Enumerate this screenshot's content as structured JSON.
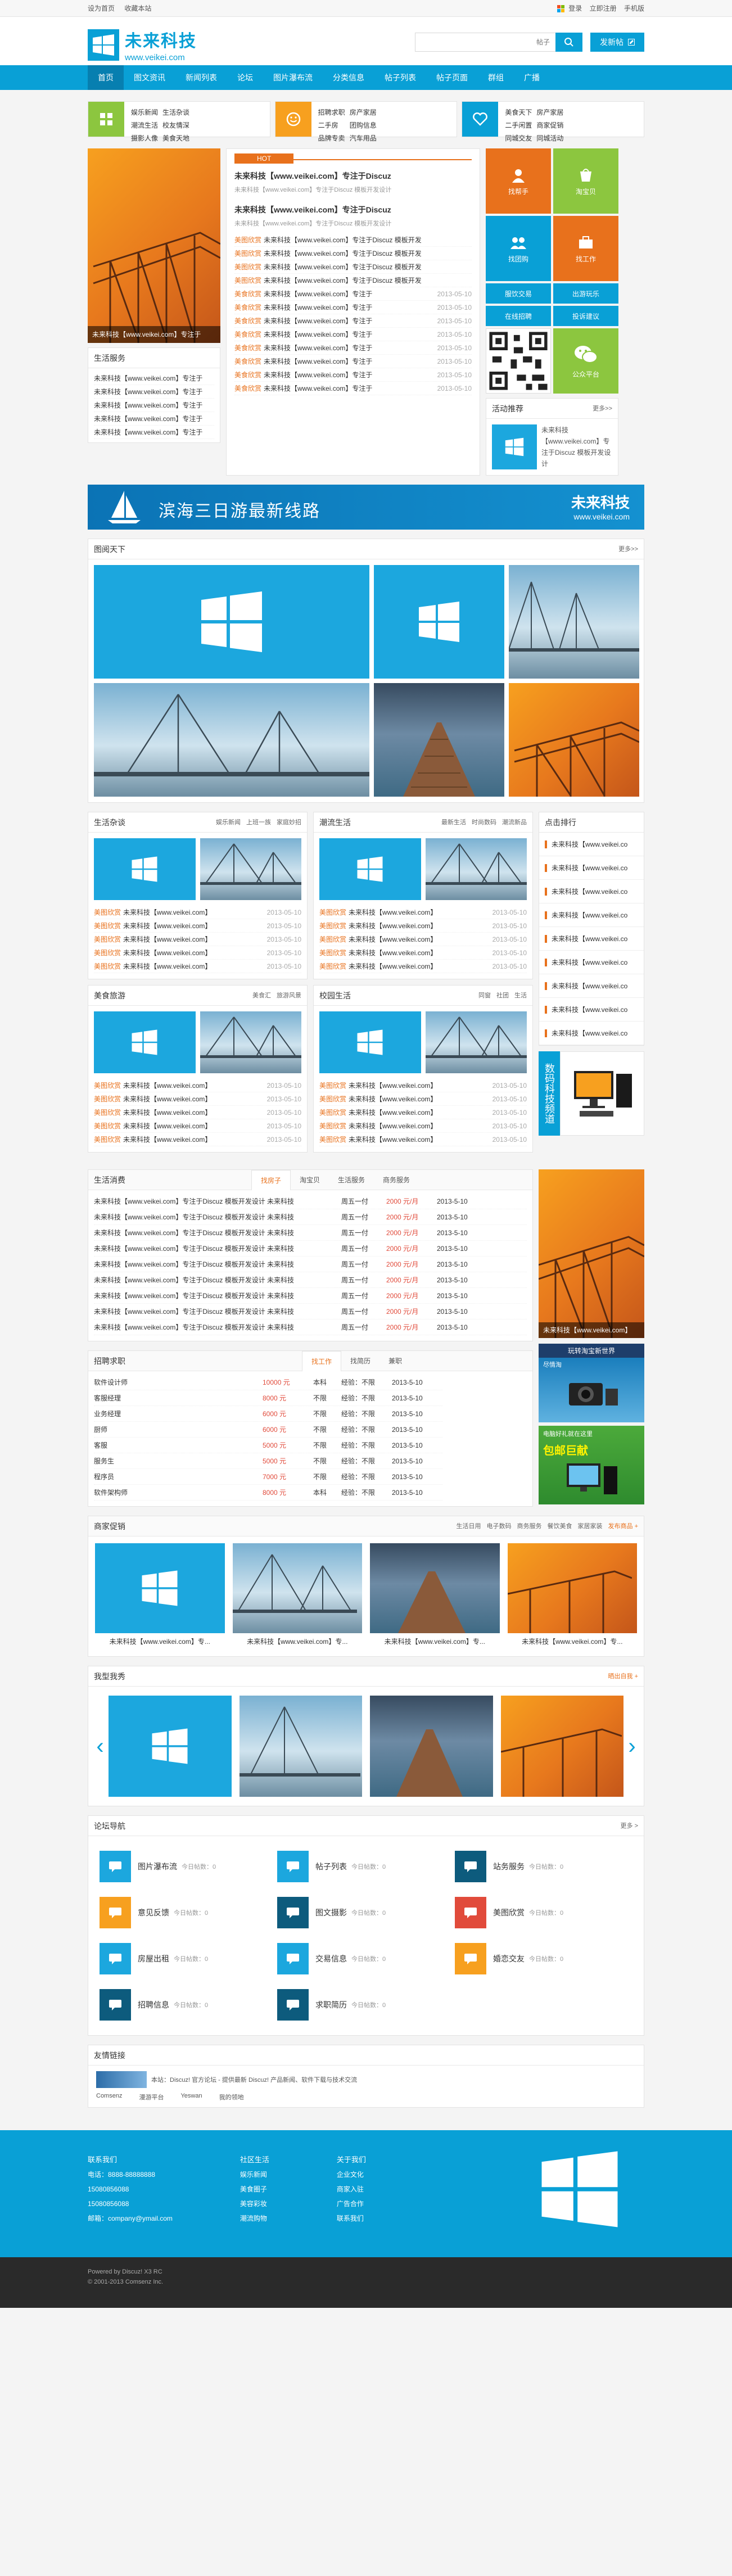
{
  "topbar": {
    "set_home": "设为首页",
    "favorite": "收藏本站",
    "login": "登录",
    "register": "立即注册",
    "mobile": "手机版"
  },
  "brand": {
    "name": "未来科技",
    "url": "www.veikei.com",
    "color": "#09a0d6"
  },
  "search": {
    "placeholder": "帖子",
    "button_icon": "search-icon"
  },
  "header": {
    "post_button": "发新帖"
  },
  "nav": [
    "首页",
    "图文资讯",
    "新闻列表",
    "论坛",
    "图片瀑布流",
    "分类信息",
    "帖子列表",
    "帖子页面",
    "群组",
    "广播"
  ],
  "subnav": [
    {
      "links": [
        "娱乐新闻",
        "生活杂谈",
        "潮流生活",
        "校友情深",
        "摄影人像",
        "美食天地"
      ]
    },
    {
      "links": [
        "招聘求职",
        "房产家居",
        "二手房",
        "团购信息",
        "品牌专卖",
        "汽车用品"
      ]
    },
    {
      "links": [
        "美食天下",
        "房产家居",
        "二手闲置",
        "商家促销",
        "同城交友",
        "同城活动"
      ]
    }
  ],
  "hero": {
    "caption": "未来科技【www.veikei.com】专注于",
    "hot_label": "HOT",
    "headline1": "未来科技【www.veikei.com】专注于Discuz",
    "desc1": "未来科技【www.veikei.com】专注于Discuz 模板开发设计",
    "headline2": "未来科技【www.veikei.com】专注于Discuz",
    "desc2": "未来科技【www.veikei.com】专注于Discuz 模板开发设计"
  },
  "hero_list": [
    {
      "tag": "美图欣赏",
      "title": "未来科技【www.veikei.com】专注于Discuz 模板开发"
    },
    {
      "tag": "美图欣赏",
      "title": "未来科技【www.veikei.com】专注于Discuz 模板开发"
    },
    {
      "tag": "美图欣赏",
      "title": "未来科技【www.veikei.com】专注于Discuz 模板开发"
    },
    {
      "tag": "美图欣赏",
      "title": "未来科技【www.veikei.com】专注于Discuz 模板开发"
    },
    {
      "tag": "美食欣赏",
      "title": "未来科技【www.veikei.com】专注于",
      "date": "2013-05-10"
    },
    {
      "tag": "美食欣赏",
      "title": "未来科技【www.veikei.com】专注于",
      "date": "2013-05-10"
    },
    {
      "tag": "美食欣赏",
      "title": "未来科技【www.veikei.com】专注于",
      "date": "2013-05-10"
    },
    {
      "tag": "美食欣赏",
      "title": "未来科技【www.veikei.com】专注于",
      "date": "2013-05-10"
    },
    {
      "tag": "美食欣赏",
      "title": "未来科技【www.veikei.com】专注于",
      "date": "2013-05-10"
    },
    {
      "tag": "美食欣赏",
      "title": "未来科技【www.veikei.com】专注于",
      "date": "2013-05-10"
    },
    {
      "tag": "美食欣赏",
      "title": "未来科技【www.veikei.com】专注于",
      "date": "2013-05-10"
    },
    {
      "tag": "美食欣赏",
      "title": "未来科技【www.veikei.com】专注于",
      "date": "2013-05-10"
    }
  ],
  "life_box": {
    "title": "生活服务",
    "items": [
      "未来科技【www.veikei.com】专注于",
      "未来科技【www.veikei.com】专注于",
      "未来科技【www.veikei.com】专注于",
      "未来科技【www.veikei.com】专注于",
      "未来科技【www.veikei.com】专注于"
    ]
  },
  "tiles": [
    {
      "label": "找帮手",
      "color": "#e8711c"
    },
    {
      "label": "淘宝贝",
      "color": "#8cc63f"
    },
    {
      "label": "找团购",
      "color": "#09a0d6"
    },
    {
      "label": "找工作",
      "color": "#e8711c"
    }
  ],
  "tile_buttons": [
    "服饮交易",
    "出游玩乐",
    "在线招聘",
    "投诉建议"
  ],
  "wechat": {
    "label": "公众平台"
  },
  "activity": {
    "title": "活动推荐",
    "more": "更多>>",
    "text": "未来科技【www.veikei.com】专注于Discuz 模板开发设计"
  },
  "banner": {
    "text": "滨海三日游最新线路",
    "brand": "未来科技",
    "url": "www.veikei.com"
  },
  "gallery": {
    "title": "图阅天下",
    "more": "更多>>"
  },
  "modules": [
    {
      "title": "生活杂谈",
      "tabs": [
        "娱乐新闻",
        "上班一族",
        "家庭妙招"
      ]
    },
    {
      "title": "潮流生活",
      "tabs": [
        "最新生活",
        "时尚数码",
        "潮流新品"
      ]
    },
    {
      "title": "美食旅游",
      "tabs": [
        "美食汇",
        "旅游风景"
      ]
    },
    {
      "title": "校园生活",
      "tabs": [
        "同窗",
        "社团",
        "生活"
      ]
    }
  ],
  "module_list": [
    {
      "tag": "美图欣赏",
      "title": "未来科技【www.veikei.com】",
      "date": "2013-05-10"
    },
    {
      "tag": "美图欣赏",
      "title": "未来科技【www.veikei.com】",
      "date": "2013-05-10"
    },
    {
      "tag": "美图欣赏",
      "title": "未来科技【www.veikei.com】",
      "date": "2013-05-10"
    },
    {
      "tag": "美图欣赏",
      "title": "未来科技【www.veikei.com】",
      "date": "2013-05-10"
    },
    {
      "tag": "美图欣赏",
      "title": "未来科技【www.veikei.com】",
      "date": "2013-05-10"
    }
  ],
  "ranking": {
    "title": "点击排行",
    "items": [
      "未来科技【www.veikei.co",
      "未来科技【www.veikei.co",
      "未来科技【www.veikei.co",
      "未来科技【www.veikei.co",
      "未来科技【www.veikei.co",
      "未来科技【www.veikei.co",
      "未来科技【www.veikei.co",
      "未来科技【www.veikei.co",
      "未来科技【www.veikei.co"
    ]
  },
  "digital": {
    "label": "数码科技频道"
  },
  "consume": {
    "title": "生活消费",
    "tabs": [
      "找房子",
      "淘宝贝",
      "生活服务",
      "商务服务"
    ],
    "rows": [
      {
        "t": "未来科技【www.veikei.com】专注于Discuz 模板开发设计 未来科技",
        "p": "周五一付",
        "price": "2000 元/月",
        "d": "2013-5-10"
      },
      {
        "t": "未来科技【www.veikei.com】专注于Discuz 模板开发设计 未来科技",
        "p": "周五一付",
        "price": "2000 元/月",
        "d": "2013-5-10"
      },
      {
        "t": "未来科技【www.veikei.com】专注于Discuz 模板开发设计 未来科技",
        "p": "周五一付",
        "price": "2000 元/月",
        "d": "2013-5-10"
      },
      {
        "t": "未来科技【www.veikei.com】专注于Discuz 模板开发设计 未来科技",
        "p": "周五一付",
        "price": "2000 元/月",
        "d": "2013-5-10"
      },
      {
        "t": "未来科技【www.veikei.com】专注于Discuz 模板开发设计 未来科技",
        "p": "周五一付",
        "price": "2000 元/月",
        "d": "2013-5-10"
      },
      {
        "t": "未来科技【www.veikei.com】专注于Discuz 模板开发设计 未来科技",
        "p": "周五一付",
        "price": "2000 元/月",
        "d": "2013-5-10"
      },
      {
        "t": "未来科技【www.veikei.com】专注于Discuz 模板开发设计 未来科技",
        "p": "周五一付",
        "price": "2000 元/月",
        "d": "2013-5-10"
      },
      {
        "t": "未来科技【www.veikei.com】专注于Discuz 模板开发设计 未来科技",
        "p": "周五一付",
        "price": "2000 元/月",
        "d": "2013-5-10"
      },
      {
        "t": "未来科技【www.veikei.com】专注于Discuz 模板开发设计 未来科技",
        "p": "周五一付",
        "price": "2000 元/月",
        "d": "2013-5-10"
      }
    ]
  },
  "side_caption": "未来科技【www.veikei.com】",
  "ads": [
    {
      "title": "玩转淘宝新世界",
      "sub": "尽情淘"
    },
    {
      "title": "电脑好礼就在这里",
      "sub": "包邮巨献"
    }
  ],
  "jobs": {
    "title": "招聘求职",
    "tabs": [
      "找工作",
      "找简历",
      "兼职"
    ],
    "rows": [
      {
        "t": "软件设计师",
        "s": "10000 元",
        "edu": "本科",
        "exp": "经验：不限",
        "d": "2013-5-10"
      },
      {
        "t": "客服经理",
        "s": "8000 元",
        "edu": "不限",
        "exp": "经验：不限",
        "d": "2013-5-10"
      },
      {
        "t": "业务经理",
        "s": "6000 元",
        "edu": "不限",
        "exp": "经验：不限",
        "d": "2013-5-10"
      },
      {
        "t": "厨师",
        "s": "6000 元",
        "edu": "不限",
        "exp": "经验：不限",
        "d": "2013-5-10"
      },
      {
        "t": "客服",
        "s": "5000 元",
        "edu": "不限",
        "exp": "经验：不限",
        "d": "2013-5-10"
      },
      {
        "t": "服务生",
        "s": "5000 元",
        "edu": "不限",
        "exp": "经验：不限",
        "d": "2013-5-10"
      },
      {
        "t": "程序员",
        "s": "7000 元",
        "edu": "不限",
        "exp": "经验：不限",
        "d": "2013-5-10"
      },
      {
        "t": "软件架构师",
        "s": "8000 元",
        "edu": "本科",
        "exp": "经验：不限",
        "d": "2013-5-10"
      }
    ]
  },
  "merchant": {
    "title": "商家促销",
    "tabs": [
      "生活日用",
      "电子数码",
      "商务服务",
      "餐饮美食",
      "家居家装"
    ],
    "publish": "发布商品 +",
    "caption": "未来科技【www.veikei.com】专..."
  },
  "show": {
    "title": "我型我秀",
    "more": "晒出自我 +"
  },
  "forum": {
    "title": "论坛导航",
    "more": "更多 >",
    "items": [
      {
        "name": "图片瀑布流",
        "count": "今日帖数：0",
        "color": "#1ca7de"
      },
      {
        "name": "帖子列表",
        "count": "今日帖数：0",
        "color": "#1ca7de"
      },
      {
        "name": "站务服务",
        "count": "今日帖数：0",
        "color": "#0d5b7d"
      },
      {
        "name": "意见反馈",
        "count": "今日帖数：0",
        "color": "#f7a01f"
      },
      {
        "name": "图文摄影",
        "count": "今日帖数：0",
        "color": "#0d5b7d"
      },
      {
        "name": "美图欣赏",
        "count": "今日帖数：0",
        "color": "#e14b3b"
      },
      {
        "name": "房屋出租",
        "count": "今日帖数：0",
        "color": "#1ca7de"
      },
      {
        "name": "交易信息",
        "count": "今日帖数：0",
        "color": "#1ca7de"
      },
      {
        "name": "婚恋交友",
        "count": "今日帖数：0",
        "color": "#f7a01f"
      },
      {
        "name": "招聘信息",
        "count": "今日帖数：0",
        "color": "#0d5b7d"
      },
      {
        "name": "求职简历",
        "count": "今日帖数：0",
        "color": "#0d5b7d"
      }
    ]
  },
  "friendlinks": {
    "title": "友情链接",
    "items": [
      "Comsenz",
      "漫游平台",
      "Yeswan",
      "我的领地"
    ],
    "desc": "本站：Discuz! 官方论坛 - 提供最新 Discuz! 产品新闻、软件下载与技术交流"
  },
  "footer": {
    "col1": [
      "联系我们",
      "电话：8888-88888888",
      "15080856088",
      "15080856088",
      "邮箱：company@ymail.com"
    ],
    "col2": [
      "社区生活",
      "娱乐新闻",
      "美食圈子",
      "美容彩妆",
      "潮流购物"
    ],
    "col3": [
      "关于我们",
      "企业文化",
      "商家入驻",
      "广告合作",
      "联系我们"
    ],
    "powered": "Powered by Discuz! X3 RC",
    "copy": "© 2001-2013 Comsenz Inc."
  }
}
